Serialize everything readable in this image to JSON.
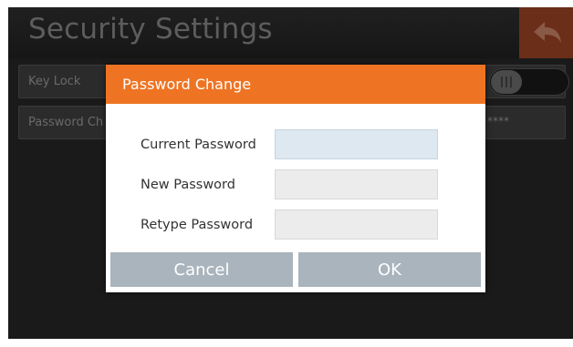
{
  "header": {
    "title": "Security Settings",
    "back_icon": "back-arrow-icon"
  },
  "settings": {
    "key_lock_label": "Key Lock",
    "password_change_label": "Password Ch",
    "password_masked": "****"
  },
  "dialog": {
    "title": "Password Change",
    "fields": [
      {
        "label": "Current Password",
        "value": ""
      },
      {
        "label": "New Password",
        "value": ""
      },
      {
        "label": "Retype Password",
        "value": ""
      }
    ],
    "cancel_label": "Cancel",
    "ok_label": "OK"
  },
  "colors": {
    "accent": "#ee7423",
    "button": "#a9b4bd",
    "focused_field": "#dde8f0"
  }
}
